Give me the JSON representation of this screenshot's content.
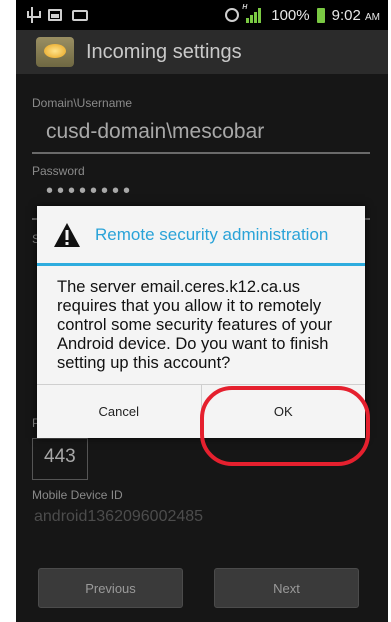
{
  "status_bar": {
    "battery": "100%",
    "time": "9:02",
    "time_suffix": "AM",
    "signal_label": "H",
    "colors": {
      "battery": "#7ac943",
      "signal": "#7ac943"
    }
  },
  "title_bar": {
    "title": "Incoming settings",
    "icon": "email-envelope-icon"
  },
  "form": {
    "domain_label": "Domain\\Username",
    "domain_value": "cusd-domain\\mescobar",
    "password_label": "Password",
    "password_value": "••••••••",
    "server_label_partial": "S",
    "port_label_partial": "P",
    "port_value": "443",
    "device_id_label": "Mobile Device ID",
    "device_id_value": "android1362096002485",
    "previous_button": "Previous",
    "next_button": "Next"
  },
  "dialog": {
    "title": "Remote security administration",
    "icon": "warning-icon",
    "message": "The server email.ceres.k12.ca.us requires that you allow it to remotely control some security features of your Android device. Do you want to finish setting up this account?",
    "cancel_label": "Cancel",
    "ok_label": "OK",
    "accent_color": "#2eacde"
  },
  "annotation": {
    "highlight_color": "#e5202e",
    "highlighted_target": "ok-button"
  }
}
